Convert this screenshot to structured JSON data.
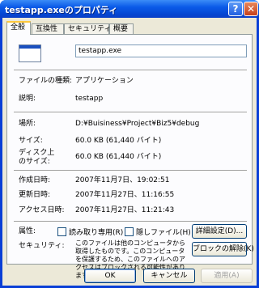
{
  "window": {
    "title": "testapp.exeのプロパティ",
    "help_button": "?",
    "close_button": "✕"
  },
  "tabs": [
    {
      "label": "全般"
    },
    {
      "label": "互換性"
    },
    {
      "label": "セキュリティ"
    },
    {
      "label": "概要"
    }
  ],
  "file": {
    "icon": "application-icon",
    "name": "testapp.exe"
  },
  "props": {
    "type_label": "ファイルの種類:",
    "type_value": "アプリケーション",
    "desc_label": "説明:",
    "desc_value": "testapp",
    "location_label": "場所:",
    "location_value": "D:¥Buisiness¥Project¥Biz5¥debug",
    "size_label": "サイズ:",
    "size_value": "60.0 KB (61,440 バイト)",
    "disk_size_label_1": "ディスク上",
    "disk_size_label_2": "のサイズ:",
    "disk_size_value": "60.0 KB (61,440 バイト)",
    "created_label": "作成日時:",
    "created_value": "2007年11月7日、19:02:51",
    "modified_label": "更新日時:",
    "modified_value": "2007年11月27日、11:16:55",
    "accessed_label": "アクセス日時:",
    "accessed_value": "2007年11月27日、11:21:43"
  },
  "attributes": {
    "label": "属性:",
    "readonly": "読み取り専用(R)",
    "hidden": "隠しファイル(H)",
    "advanced_button": "詳細設定(D)..."
  },
  "security": {
    "label": "セキュリティ:",
    "text": "このファイルは他のコンピュータから取得したものです。このコンピュータを保護するため、このファイルへのアクセスはブロックされる可能性があります。",
    "unblock_button": "ブロックの解除(K)"
  },
  "footer": {
    "ok": "OK",
    "cancel": "キャンセル",
    "apply": "適用(A)"
  }
}
